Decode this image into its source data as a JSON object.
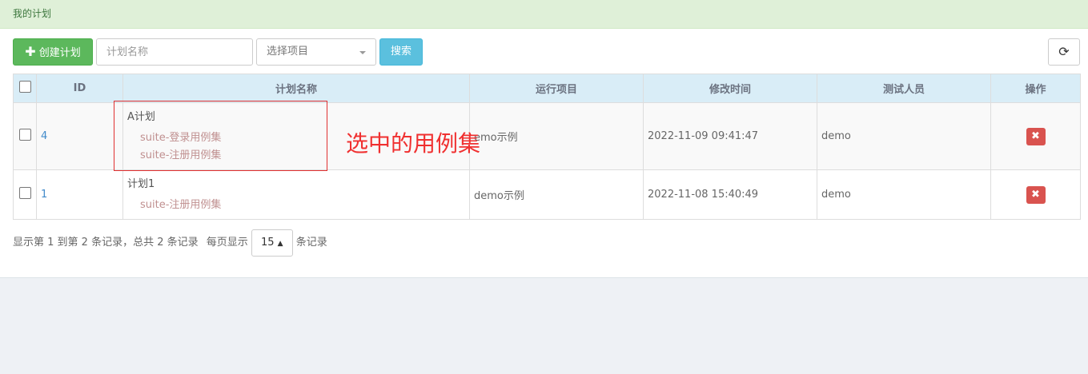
{
  "header": {
    "title": "我的计划"
  },
  "toolbar": {
    "create_label": "创建计划",
    "plan_name_placeholder": "计划名称",
    "project_select": "选择项目",
    "search_label": "搜索",
    "refresh_icon": "refresh-icon"
  },
  "table": {
    "columns": [
      "ID",
      "计划名称",
      "运行项目",
      "修改时间",
      "测试人员",
      "操作"
    ],
    "rows": [
      {
        "id": "4",
        "name": "A计划",
        "suites": [
          "suite-登录用例集",
          "suite-注册用例集"
        ],
        "project": "emo示例",
        "modified": "2022-11-09 09:41:47",
        "tester": "demo"
      },
      {
        "id": "1",
        "name": "计划1",
        "suites": [
          "suite-注册用例集"
        ],
        "project": "demo示例",
        "modified": "2022-11-08 15:40:49",
        "tester": "demo"
      }
    ]
  },
  "annotation": {
    "text": "选中的用例集"
  },
  "pagination": {
    "summary": "显示第 1 到第 2 条记录，总共 2 条记录",
    "per_page_prefix": "每页显示",
    "page_size": "15",
    "per_page_suffix": "条记录"
  },
  "colors": {
    "success": "#5cb85c",
    "info": "#5bc0de",
    "danger": "#d9534f",
    "header_bg": "#dff0d8",
    "table_head_bg": "#d9edf7"
  }
}
